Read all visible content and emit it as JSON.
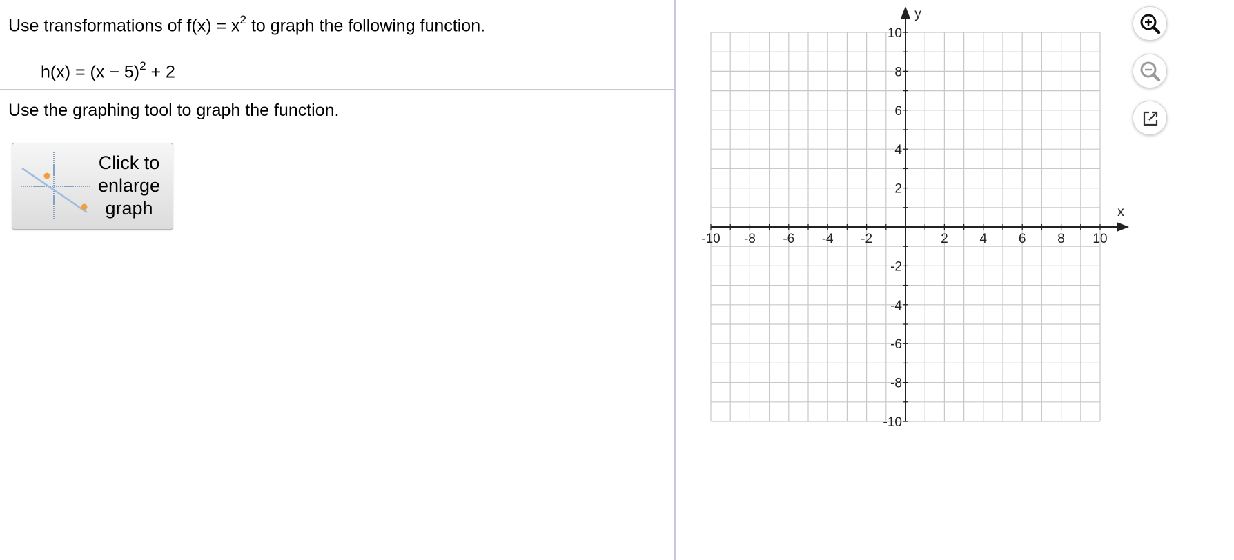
{
  "question": {
    "prefix": "Use transformations of f(x) = x",
    "exponent": "2",
    "suffix": " to graph the following function."
  },
  "function": {
    "prefix": "h(x) = (x − 5)",
    "exponent": "2",
    "suffix": " + 2"
  },
  "instruction": "Use the graphing tool to graph the function.",
  "enlarge_button": {
    "line1": "Click to",
    "line2": "enlarge",
    "line3": "graph"
  },
  "graph": {
    "x_axis_label": "x",
    "y_axis_label": "y",
    "x_tick_labels": [
      "-10",
      "-8",
      "-6",
      "-4",
      "-2",
      "2",
      "4",
      "6",
      "8",
      "10"
    ],
    "y_tick_labels": [
      "10",
      "8",
      "6",
      "4",
      "2",
      "-2",
      "-4",
      "-6",
      "-8",
      "-10"
    ],
    "x_range": [
      -10,
      10
    ],
    "y_range": [
      -10,
      10
    ],
    "grid_step": 1,
    "label_step": 2,
    "grid_color": "#c8c8c8",
    "axis_color": "#222222"
  },
  "tools": {
    "zoom_in_icon": "zoom-in-icon",
    "zoom_out_icon": "zoom-out-icon",
    "popout_icon": "external-link-icon"
  }
}
